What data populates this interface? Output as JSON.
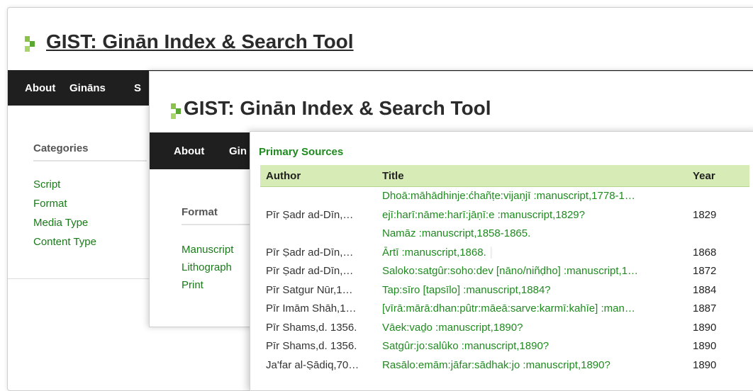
{
  "app": {
    "title": "GIST: Ginān Index & Search Tool"
  },
  "nav_back": [
    "About",
    "Gināns",
    "S"
  ],
  "nav_mid": [
    "About",
    "Gin"
  ],
  "sidebar_back": {
    "heading": "Categories",
    "items": [
      "Script",
      "Format",
      "Media Type",
      "Content Type"
    ]
  },
  "sidebar_mid": {
    "heading": "Format",
    "items": [
      "Manuscript",
      "Lithograph",
      "Print"
    ]
  },
  "primary": {
    "heading": "Primary Sources",
    "columns": {
      "author": "Author",
      "title": "Title",
      "year": "Year"
    },
    "rows": [
      {
        "author": "",
        "title": "Dhoā:māhādhinje:ćhañṭe:vijaṇjī :manuscript,1778-1…",
        "year": ""
      },
      {
        "author": "Pīr Ṣadr ad-Dīn,…",
        "title": "ejī:harī:nāme:harī:jāṇī:e :manuscript,1829?",
        "year": "1829"
      },
      {
        "author": "",
        "title": "Namāz :manuscript,1858-1865.",
        "year": ""
      },
      {
        "author": "Pīr Ṣadr ad-Dīn,…",
        "title": "Ārtī :manuscript,1868.",
        "year": "1868"
      },
      {
        "author": "Pīr Ṣadr ad-Dīn,…",
        "title": "Saloko:satgûr:soho:dev [nāno/niñḍho] :manuscript,1…",
        "year": "1872"
      },
      {
        "author": "Pīr Satgur Nūr,1…",
        "title": "Tap:sīro [tapsīlo] :manuscript,1884?",
        "year": "1884"
      },
      {
        "author": "Pīr Imām Shāh,1…",
        "title": "[vīrā:mārā:dhan:pûtr:māeā:sarve:karmī:kahīe] :man…",
        "year": "1887"
      },
      {
        "author": "Pīr Shams,d. 1356.",
        "title": "Vāek:vaḏo :manuscript,1890?",
        "year": "1890"
      },
      {
        "author": "Pīr Shams,d. 1356.",
        "title": "Satgûr:jo:salûko :manuscript,1890?",
        "year": "1890"
      },
      {
        "author": "Ja'far al-Ṣādiq,70…",
        "title": "Rasālo:emām:jāfar:sādhak:jo :manuscript,1890?",
        "year": "1890"
      }
    ]
  }
}
